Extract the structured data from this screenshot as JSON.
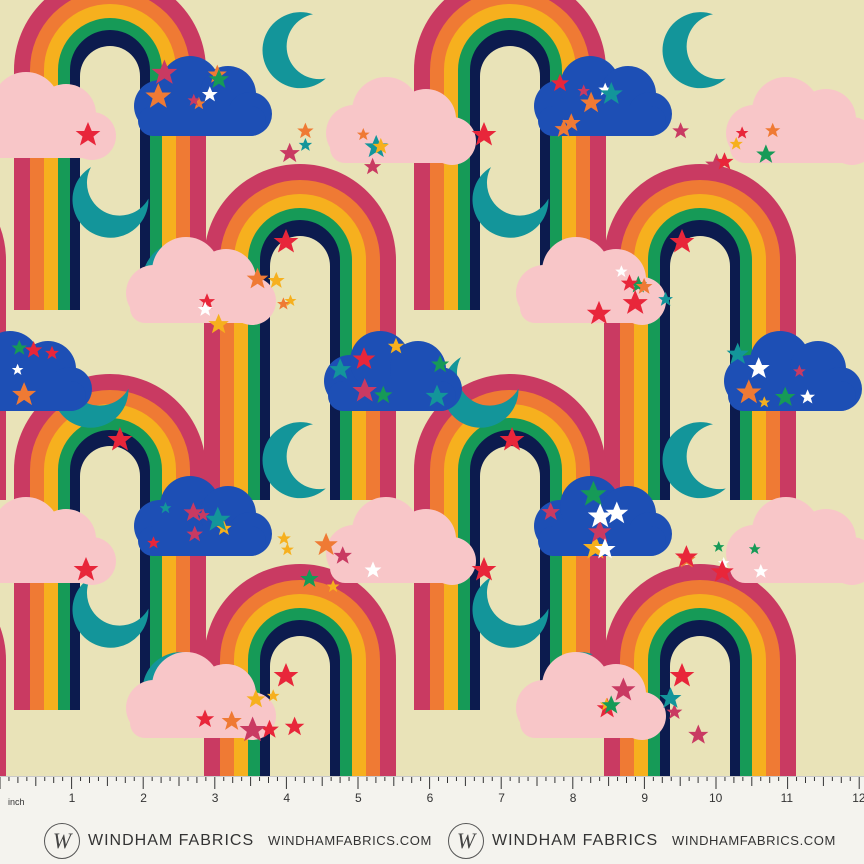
{
  "product": {
    "brand": "WINDHAM FABRICS",
    "website": "WINDHAMFABRICS.COM",
    "logo_letter": "W"
  },
  "ruler": {
    "unit": "inch",
    "numbers": [
      "1",
      "2",
      "3",
      "4",
      "5",
      "6",
      "7",
      "8",
      "9",
      "10",
      "11",
      "12"
    ]
  },
  "palette": {
    "background": "#e9e3b8",
    "navy": "#0c1b4e",
    "magenta": "#c93a62",
    "orange": "#ef7a34",
    "yellow": "#f6b01e",
    "green": "#169a57",
    "teal": "#13959a",
    "pink_cloud": "#f8c6c8",
    "blue_cloud": "#1d4fb5",
    "red_star": "#e8263a",
    "white": "#ffffff"
  }
}
